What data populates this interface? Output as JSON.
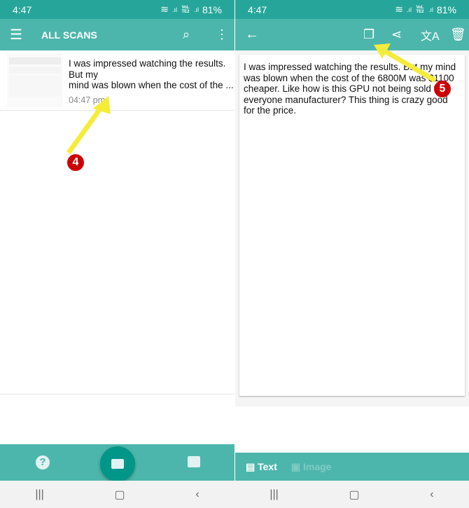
{
  "status": {
    "time": "4:47",
    "battery": "81%",
    "network": "VoLTE2"
  },
  "left": {
    "title": "ALL SCANS",
    "scan": {
      "text": "I was impressed watching the results. But my\nmind was blown when the cost of the ...",
      "time": "04:47 pm"
    }
  },
  "right": {
    "body": "I was impressed watching the results. But my mind was blown when the cost of the 6800M was $1100 cheaper. Like how is this GPU not being sold to everyone manufacturer? This thing is crazy good for the price.",
    "tabs": {
      "text": "Text",
      "image": "Image"
    }
  },
  "annotations": {
    "a": "4",
    "b": "5",
    "color": "#f5ec3a"
  },
  "colors": {
    "primary": "#4db6ac",
    "status": "#26a69a",
    "fab": "#009688"
  }
}
